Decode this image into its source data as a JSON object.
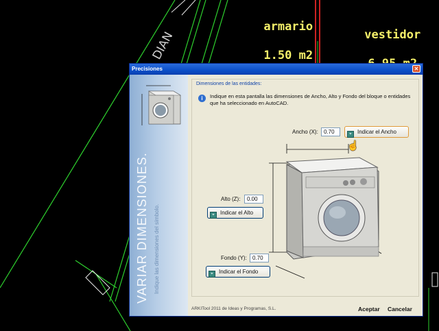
{
  "cad": {
    "room_labels": [
      {
        "name": "armario",
        "area": "1.50 m2"
      },
      {
        "name": "vestidor",
        "area": "6.95 m2"
      }
    ],
    "drawing_text": "DIAN",
    "colors": {
      "background": "#000000",
      "line": "#2ed12e",
      "label": "#f5f06a",
      "wall": "#cc2222"
    }
  },
  "dialog": {
    "title": "Precisiones",
    "close_icon": "close-icon",
    "sidebar": {
      "title": "VARIAR DIMENSIONES.",
      "subtitle": "Indique las dimensiones del símbolo."
    },
    "panel_header": "Dimensiones de las entidades:",
    "info_text": "Indique en esta pantalla las dimensiones de Ancho, Alto y Fondo del bloque o entidades que ha seleccionado en AutoCAD.",
    "ancho": {
      "label": "Ancho (X):",
      "value": "0.70",
      "button": "Indicar el Ancho"
    },
    "alto": {
      "label": "Alto (Z):",
      "value": "0.00",
      "button": "Indicar el Alto"
    },
    "fondo": {
      "label": "Fondo (Y):",
      "value": "0.70",
      "button": "Indicar el Fondo"
    },
    "footer": "ARKITool 2011 de Ideas y Programas, S.L.",
    "accept": "Aceptar",
    "cancel": "Cancelar"
  }
}
